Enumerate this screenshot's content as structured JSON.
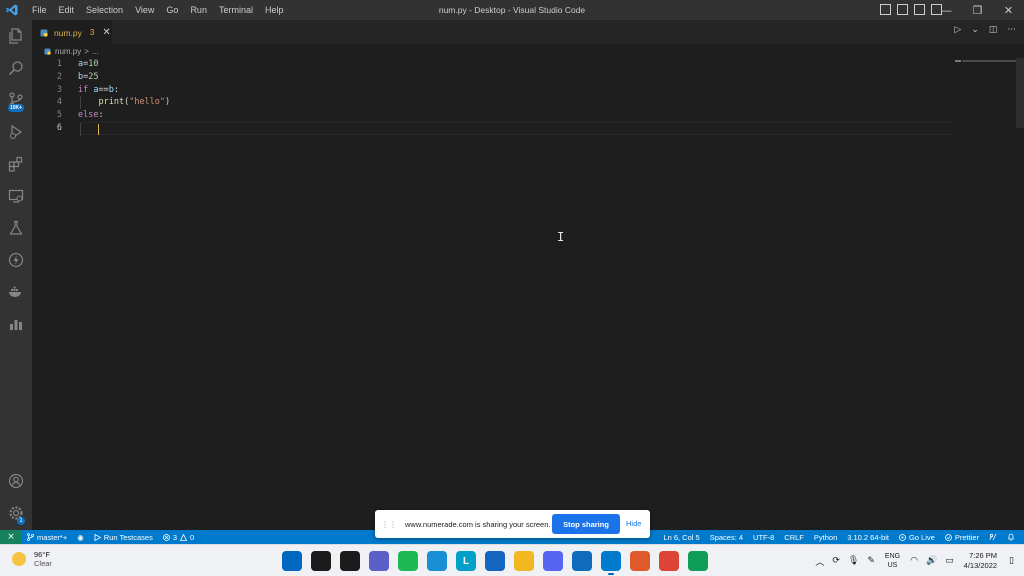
{
  "window": {
    "title": "num.py - Desktop - Visual Studio Code",
    "menu": [
      "File",
      "Edit",
      "Selection",
      "View",
      "Go",
      "Run",
      "Terminal",
      "Help"
    ],
    "controls": {
      "minimize": "—",
      "restore": "❐",
      "close": "✕"
    }
  },
  "activity_bar": {
    "items": [
      "files-icon",
      "search-icon",
      "source-control-icon",
      "run-debug-icon",
      "extensions-icon",
      "remote-explorer-icon",
      "testing-icon",
      "lightning-icon",
      "docker-icon",
      "chart-icon"
    ],
    "source_control_badge": "10K+",
    "accounts_icon": "account-icon",
    "manage_icon": "gear-icon",
    "manage_badge": "1"
  },
  "tab": {
    "name": "num.py",
    "problems": "3",
    "close": "✕"
  },
  "editor_actions": {
    "run": "▷",
    "run_menu": "⌄",
    "split": "◫",
    "more": "···"
  },
  "breadcrumb": {
    "file": "num.py",
    "sep": ">",
    "rest": "..."
  },
  "editor": {
    "line_numbers": [
      "1",
      "2",
      "3",
      "4",
      "5",
      "6"
    ],
    "lines": [
      [
        {
          "t": "a",
          "c": "var"
        },
        {
          "t": "=",
          "c": "op"
        },
        {
          "t": "10",
          "c": "num"
        }
      ],
      [
        {
          "t": "b",
          "c": "var"
        },
        {
          "t": "=",
          "c": "op"
        },
        {
          "t": "25",
          "c": "num"
        }
      ],
      [
        {
          "t": "if",
          "c": "kw"
        },
        {
          "t": " ",
          "c": "op"
        },
        {
          "t": "a",
          "c": "var"
        },
        {
          "t": "==",
          "c": "op"
        },
        {
          "t": "b",
          "c": "var"
        },
        {
          "t": ":",
          "c": "op"
        }
      ],
      [
        {
          "t": "    ",
          "c": "op"
        },
        {
          "t": "print",
          "c": "fn"
        },
        {
          "t": "(",
          "c": "op"
        },
        {
          "t": "\"hello\"",
          "c": "str"
        },
        {
          "t": ")",
          "c": "op"
        }
      ],
      [
        {
          "t": "else",
          "c": "kw"
        },
        {
          "t": ":",
          "c": "op"
        }
      ],
      []
    ],
    "cursor_line": 6,
    "mouse_cursor": "I"
  },
  "statusbar": {
    "remote": "⨯",
    "branch": "master*+",
    "sync_icon": "◉",
    "run_testcases": "Run Testcases",
    "errors": "3",
    "warnings": "0",
    "position": "Ln 6, Col 5",
    "spaces": "Spaces: 4",
    "encoding": "UTF-8",
    "eol": "CRLF",
    "language": "Python",
    "interpreter": "3.10.2 64-bit",
    "golive": "Go Live",
    "prettier": "Prettier"
  },
  "share_bar": {
    "message": "www.numerade.com is sharing your screen.",
    "stop": "Stop sharing",
    "hide": "Hide"
  },
  "taskbar": {
    "temperature": "96°F",
    "condition": "Clear",
    "apps": [
      {
        "name": "start-icon",
        "label": "",
        "color": "#0067c0"
      },
      {
        "name": "search-icon",
        "label": "",
        "color": "#1b1b1b"
      },
      {
        "name": "task-view-icon",
        "label": "",
        "color": "#1b1b1b"
      },
      {
        "name": "chat-icon",
        "label": "",
        "color": "#5b5fc7"
      },
      {
        "name": "spotify-icon",
        "label": "",
        "color": "#1db954"
      },
      {
        "name": "edge-icon",
        "label": "",
        "color": "#1a8fd6"
      },
      {
        "name": "l-app-icon",
        "label": "L",
        "color": "#00a0c8"
      },
      {
        "name": "calendar-icon",
        "label": "",
        "color": "#1565c0"
      },
      {
        "name": "file-explorer-icon",
        "label": "",
        "color": "#f2b820"
      },
      {
        "name": "discord-icon",
        "label": "",
        "color": "#5865f2"
      },
      {
        "name": "mail-icon",
        "label": "",
        "color": "#0f6cbd"
      },
      {
        "name": "vscode-icon",
        "label": "",
        "color": "#007acc"
      },
      {
        "name": "matlab-icon",
        "label": "",
        "color": "#e05a2b"
      },
      {
        "name": "chrome-icon",
        "label": "",
        "color": "#db4437"
      },
      {
        "name": "chrome-alt-icon",
        "label": "",
        "color": "#0f9d58"
      }
    ],
    "lang_top": "ENG",
    "lang_bottom": "US",
    "time": "7:26 PM",
    "date": "4/13/2022"
  }
}
